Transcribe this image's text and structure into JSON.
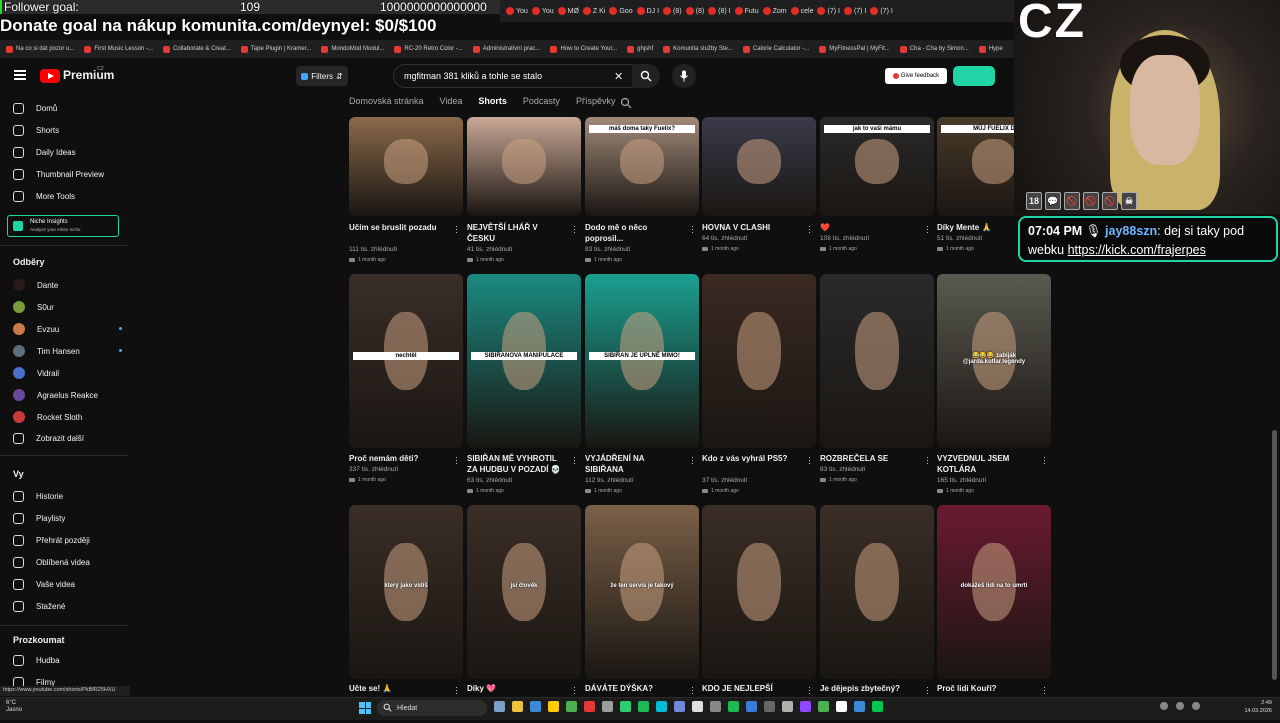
{
  "overlay": {
    "follower_label": "Follower goal:",
    "follower_count": "109",
    "follower_target": "1000000000000000",
    "follower_progress": 1e-13,
    "donate_text": "Donate goal na nákup komunita.com/deynyel: $0/$100"
  },
  "browser": {
    "tabs": [
      "You",
      "You",
      "MØ",
      "Z Ki",
      "Goo",
      "DJ I",
      "(8)",
      "(8)",
      "(8) I",
      "Futu",
      "Zom",
      "cele",
      "(7) I",
      "(7) I",
      "(7) I"
    ],
    "bookmarks": [
      "Na co si dát pozor u...",
      "First Music Lesson -...",
      "Collaborate & Creat...",
      "Tape Plugin | Kramer...",
      "MondoMod Modul...",
      "RC-20 Retro Color -...",
      "Administrativní prac...",
      "How to Create Your...",
      "ghjshf",
      "Komunita služby Ste...",
      "Calorie Calculator -...",
      "MyFitnessPal | MyFit...",
      "Cha - Cha by Simon...",
      "Hype"
    ],
    "status_url": "https://www.youtube.com/shorts/PkBfR25HXU"
  },
  "youtube": {
    "logo_text": "Premium",
    "country": "CZ",
    "filters_label": "Filters",
    "search_value": "mgfitman 381 kliků a tohle se stalo",
    "feedback_label": "Give feedback",
    "channel_tabs": [
      {
        "label": "Domovská stránka",
        "active": false
      },
      {
        "label": "Videa",
        "active": false
      },
      {
        "label": "Shorts",
        "active": true
      },
      {
        "label": "Podcasty",
        "active": false
      },
      {
        "label": "Příspěvky",
        "active": false
      }
    ],
    "chat_tag": "Cha"
  },
  "sidebar": {
    "main": [
      {
        "label": "Domů",
        "icon": "home-icon"
      },
      {
        "label": "Shorts",
        "icon": "shorts-icon"
      },
      {
        "label": "Daily Ideas",
        "icon": "ideas-icon"
      },
      {
        "label": "Thumbnail Preview",
        "icon": "thumbnail-icon"
      },
      {
        "label": "More Tools",
        "icon": "tools-icon"
      }
    ],
    "niche_title": "Niche Insights",
    "niche_sub": "Analyze your entire niche",
    "subs_header": "Odběry",
    "subs": [
      {
        "label": "Dante",
        "color": "#2a1b1b",
        "dot": false
      },
      {
        "label": "S0ur",
        "color": "#7a9b3a",
        "dot": false
      },
      {
        "label": "Evzuu",
        "color": "#c97b4a",
        "dot": true
      },
      {
        "label": "Tim Hansen",
        "color": "#5c6f7a",
        "dot": true
      },
      {
        "label": "Vidrail",
        "color": "#4a6fc9",
        "dot": false
      },
      {
        "label": "Agraelus Reakce",
        "color": "#6a4a9b",
        "dot": false
      },
      {
        "label": "Rocket Sloth",
        "color": "#c93a3a",
        "dot": false
      }
    ],
    "show_more": "Zobrazit další",
    "you_header": "Vy",
    "you": [
      {
        "label": "Historie",
        "icon": "history-icon"
      },
      {
        "label": "Playlisty",
        "icon": "playlist-icon"
      },
      {
        "label": "Přehrát později",
        "icon": "watch-later-icon"
      },
      {
        "label": "Oblíbená videa",
        "icon": "liked-icon"
      },
      {
        "label": "Vaše videa",
        "icon": "your-videos-icon"
      },
      {
        "label": "Stažené",
        "icon": "download-icon"
      }
    ],
    "explore_header": "Prozkoumat",
    "explore": [
      {
        "label": "Hudba",
        "icon": "music-icon"
      },
      {
        "label": "Filmy",
        "icon": "movies-icon"
      }
    ]
  },
  "rows": [
    [
      {
        "title": "Učím se bruslit pozadu",
        "views": "111 tis. zhlédnutí",
        "ago": "1 month ago",
        "bg": "#8a6a4a",
        "cap": ""
      },
      {
        "title": "NEJVĚTŠÍ LHÁŘ V ČESKU",
        "views": "41 tis. zhlédnutí",
        "ago": "1 month ago",
        "bg": "#c9a896",
        "cap": ""
      },
      {
        "title": "Dodo mě o něco poprosil...",
        "views": "83 tis. zhlédnutí",
        "ago": "1 month ago",
        "bg": "#a08a7a",
        "cap": "máš doma taky Fuelix?"
      },
      {
        "title": "HOVNA V CLASHI",
        "views": "64 tis. zhlédnutí",
        "ago": "1 month ago",
        "bg": "#3a3a4a",
        "cap": ""
      },
      {
        "title": "❤️",
        "views": "108 tis. zhlédnutí",
        "ago": "1 month ago",
        "bg": "#2a2a2a",
        "cap": "jak to vaši mámu"
      },
      {
        "title": "Díky Mente 🙏",
        "views": "51 tis. zhlédnutí",
        "ago": "1 month ago",
        "bg": "#4a3a2a",
        "cap": "MŮJ FUELIX D"
      }
    ],
    [
      {
        "title": "Proč nemám děti?",
        "views": "337 tis. zhlédnutí",
        "ago": "1 month ago",
        "bg": "#3a2e28",
        "cap": "nechtěl"
      },
      {
        "title": "SIBIŘAN MĚ VYHROTIL ZA HUDBU V POZADÍ 💀",
        "views": "63 tis. zhlédnutí",
        "ago": "1 month ago",
        "bg": "#1a8a80",
        "cap": "SIBIŘANOVA MANIPULACE"
      },
      {
        "title": "VYJÁDŘENÍ NA SIBIŘANA",
        "views": "112 tis. zhlédnutí",
        "ago": "1 month ago",
        "bg": "#1aa090",
        "cap": "SIBIŘAN JE ÚPLNĚ MIMO!"
      },
      {
        "title": "Kdo z vás vyhrál PS5?",
        "views": "37 tis. zhlédnutí",
        "ago": "1 month ago",
        "bg": "#3a2a22",
        "cap": ""
      },
      {
        "title": "ROZBREČELA SE",
        "views": "83 tis. zhlédnutí",
        "ago": "1 month ago",
        "bg": "#2a2a2a",
        "cap": ""
      },
      {
        "title": "VYZVEDNUL JSEM KOTLÁRA",
        "views": "165 tis. zhlédnutí",
        "ago": "1 month ago",
        "bg": "#5a5a50",
        "cap": "😂😂😂 zabiják @jarda.kotlar.legendy"
      }
    ],
    [
      {
        "title": "Učte se! 🙏",
        "views": "",
        "ago": "",
        "bg": "#3a2e26",
        "cap": "který jako vidíš"
      },
      {
        "title": "Díky 💖",
        "views": "",
        "ago": "",
        "bg": "#3a2e26",
        "cap": "jsi člověk"
      },
      {
        "title": "DÁVÁTE DÝŠKA?",
        "views": "",
        "ago": "",
        "bg": "#7a6048",
        "cap": "že ten servis je takový"
      },
      {
        "title": "KDO JE NEJLEPŠÍ",
        "views": "",
        "ago": "",
        "bg": "#3a2e26",
        "cap": ""
      },
      {
        "title": "Je dějepis zbytečný?",
        "views": "",
        "ago": "",
        "bg": "#3a2e26",
        "cap": ""
      },
      {
        "title": "Proč lidi Kouří?",
        "views": "",
        "ago": "",
        "bg": "#6a1a30",
        "cap": "dokážeš lidi na to umrtí"
      }
    ]
  ],
  "stream": {
    "cam_label": "CZ",
    "badges": [
      "18",
      "💬",
      "🚫",
      "🚫",
      "🚫",
      "☠"
    ],
    "chat": {
      "time": "07:04 PM",
      "user": "jay88szn",
      "message": ": dej si taky pod webku ",
      "link": "https://kick.com/frajerpes"
    }
  },
  "taskbar": {
    "weather_temp": "6°C",
    "weather_desc": "Jasno",
    "search_placeholder": "Hledat",
    "time": "2:49",
    "date": "14.03.2026",
    "apps": [
      "#7aa0c8",
      "#f0c040",
      "#3a8ad8",
      "#ffcc00",
      "#4caf50",
      "#e53935",
      "#9e9e9e",
      "#2ecc71",
      "#1db954",
      "#00bcd4",
      "#7289da",
      "#e0e0e0",
      "#888888",
      "#1db954",
      "#3a7ad8",
      "#666666",
      "#b0b0b0",
      "#9146ff",
      "#4caf50",
      "#ffffff",
      "#3a8ad8",
      "#00c853"
    ]
  }
}
